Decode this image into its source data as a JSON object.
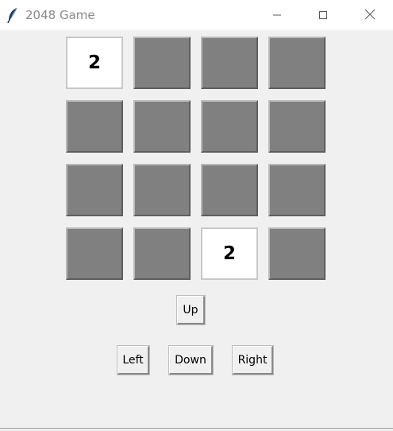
{
  "window": {
    "title": "2048 Game",
    "icon": "feather-icon",
    "controls": {
      "minimize": "minimize-icon",
      "maximize": "maximize-icon",
      "close": "close-icon"
    }
  },
  "board": {
    "rows": [
      [
        "2",
        "",
        "",
        ""
      ],
      [
        "",
        "",
        "",
        ""
      ],
      [
        "",
        "",
        "",
        ""
      ],
      [
        "",
        "",
        "2",
        ""
      ]
    ],
    "colors": {
      "empty_tile": "#808080",
      "filled_tile": "#ffffff",
      "background": "#f0f0f0"
    }
  },
  "controls": {
    "up_label": "Up",
    "left_label": "Left",
    "down_label": "Down",
    "right_label": "Right"
  }
}
